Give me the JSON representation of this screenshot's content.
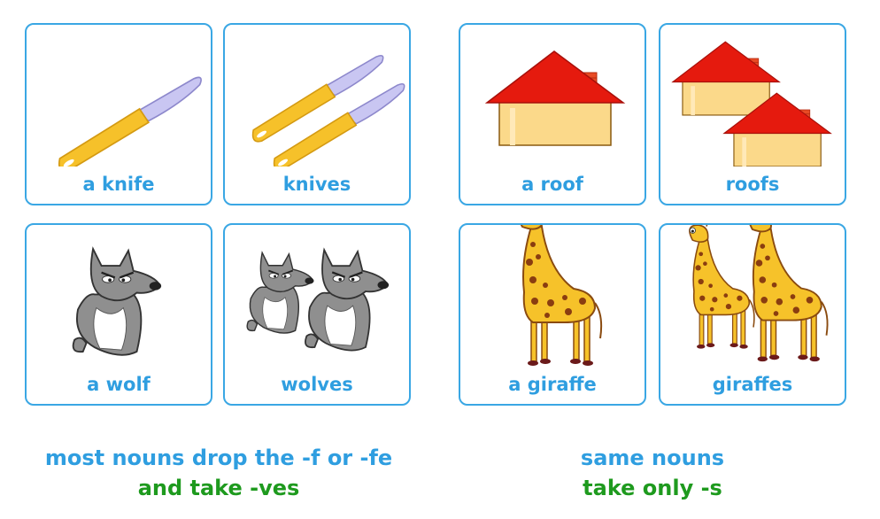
{
  "cards": [
    {
      "label": "a knife",
      "picture": "knife-icon"
    },
    {
      "label": "knives",
      "picture": "knives-icon"
    },
    {
      "label": "a roof",
      "picture": "house-icon"
    },
    {
      "label": "roofs",
      "picture": "houses-icon"
    },
    {
      "label": "a wolf",
      "picture": "wolf-icon"
    },
    {
      "label": "wolves",
      "picture": "wolves-icon"
    },
    {
      "label": "a giraffe",
      "picture": "giraffe-icon"
    },
    {
      "label": "giraffes",
      "picture": "giraffes-icon"
    }
  ],
  "captions": {
    "left": {
      "line1": "most nouns drop the -f or -fe",
      "line2": "and take -ves"
    },
    "right": {
      "line1": "same nouns",
      "line2": "take only -s"
    }
  },
  "colors": {
    "card_border": "#3aa7e4",
    "label_blue": "#2f9ee0",
    "caption_green": "#1e9a1e"
  }
}
